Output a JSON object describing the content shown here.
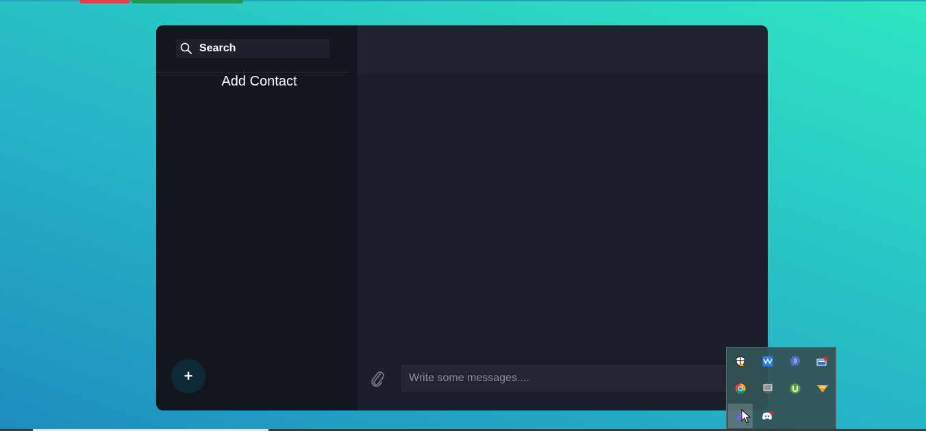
{
  "browser": {
    "tab_colors": [
      "#e0414b",
      "#1e9a52"
    ]
  },
  "sidebar": {
    "search": {
      "label": "Search",
      "icon": "search-icon"
    },
    "add_contact_label": "Add Contact",
    "fab": {
      "label": "+",
      "icon": "plus-icon"
    }
  },
  "chat": {
    "composer": {
      "placeholder": "Write some messages....",
      "attach_icon": "paperclip-icon"
    }
  },
  "system_tray": {
    "icons": [
      "security-shield-icon",
      "waves-app-icon",
      "chat-bubble-icon",
      "network-icon",
      "chrome-icon",
      "monitor-icon",
      "utorrent-icon",
      "vlc-icon",
      "prism-app-icon",
      "discord-icon"
    ]
  },
  "colors": {
    "sidebar_bg": "#13151f",
    "chat_bg": "#1a1d2a",
    "header_bg": "#202230",
    "fab_bg": "#0e2a37"
  }
}
